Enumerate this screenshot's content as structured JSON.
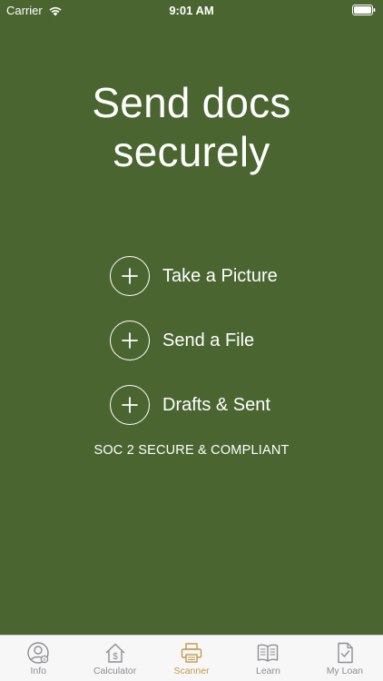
{
  "status_bar": {
    "carrier": "Carrier",
    "time": "9:01 AM"
  },
  "hero": {
    "title_line1": "Send docs",
    "title_line2": "securely"
  },
  "actions": [
    {
      "label": "Take a Picture",
      "icon": "plus-circle-icon"
    },
    {
      "label": "Send a File",
      "icon": "plus-circle-icon"
    },
    {
      "label": "Drafts & Sent",
      "icon": "plus-circle-icon"
    }
  ],
  "compliance_text": "SOC 2 SECURE & COMPLIANT",
  "tab_bar": {
    "tabs": [
      {
        "label": "Info",
        "icon": "person-icon",
        "active": false
      },
      {
        "label": "Calculator",
        "icon": "house-dollar-icon",
        "active": false
      },
      {
        "label": "Scanner",
        "icon": "scanner-icon",
        "active": true
      },
      {
        "label": "Learn",
        "icon": "book-icon",
        "active": false
      },
      {
        "label": "My Loan",
        "icon": "document-check-icon",
        "active": false
      }
    ]
  },
  "colors": {
    "background": "#4a6530",
    "tab_active": "#c39a4f",
    "tab_inactive": "#8e8e93",
    "tab_bar_bg": "#f7f7f7"
  }
}
